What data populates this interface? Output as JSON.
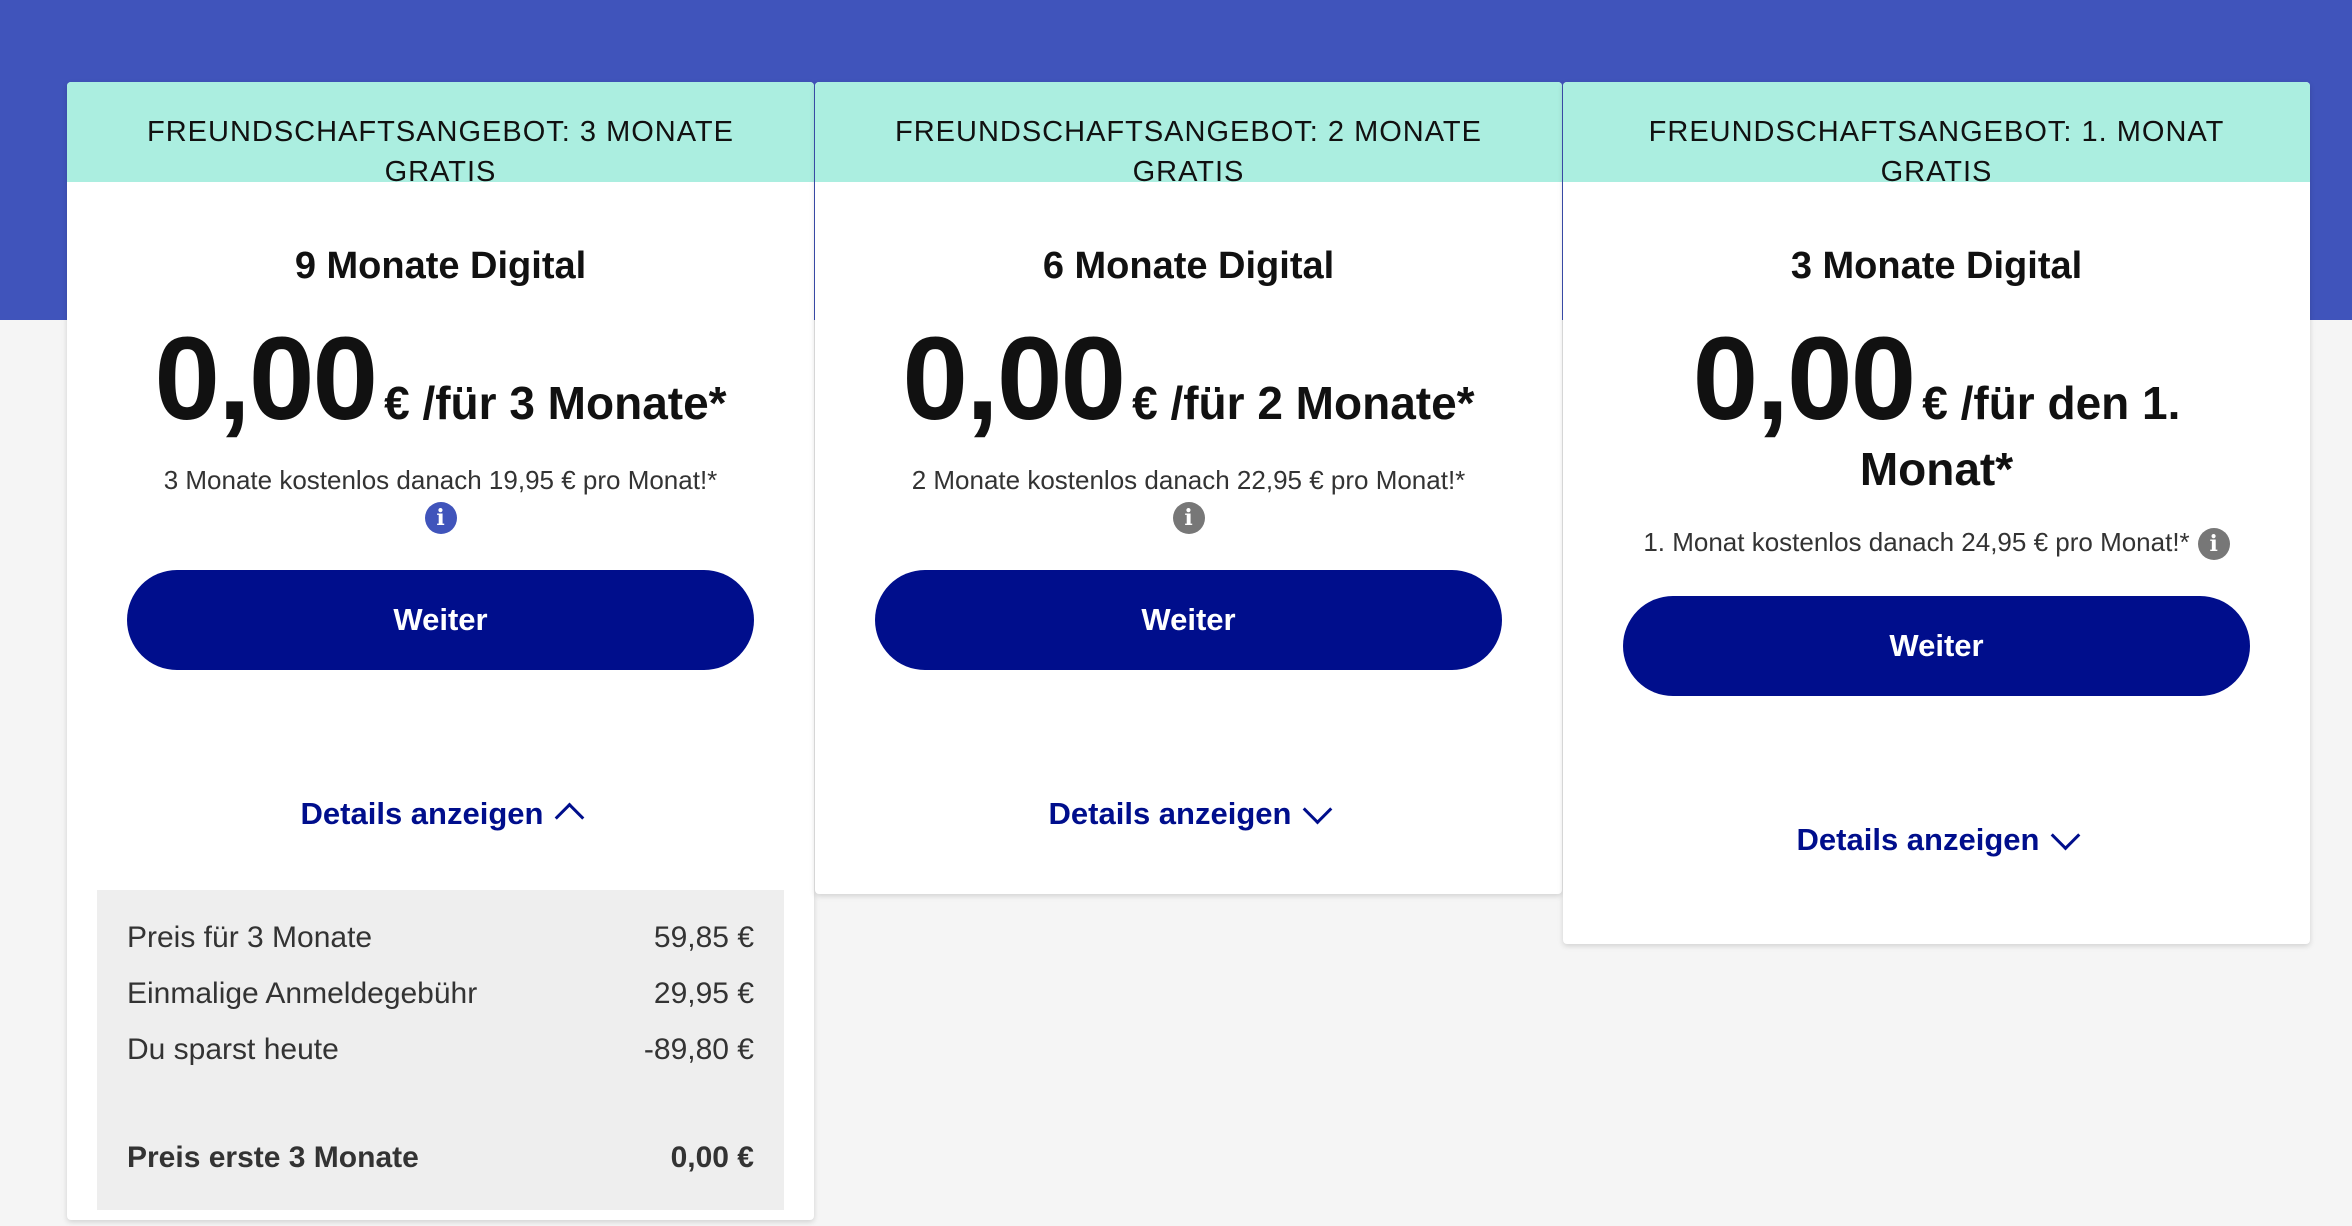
{
  "colors": {
    "top_band": "#4054bb",
    "offer_banner": "#abeee0",
    "button": "#000e8c",
    "link": "#000e8c",
    "info_icon_active": "#4054bb",
    "info_icon_muted": "#777777"
  },
  "plans": [
    {
      "offer_banner": "FREUNDSCHAFTSANGEBOT: 3 MONATE GRATIS",
      "title": "9 Monate Digital",
      "price": "0,00",
      "price_suffix": "€ /für 3 Monate*",
      "note": "3 Monate kostenlos danach 19,95 € pro Monat!*",
      "info_icon": "info-icon",
      "info_glyph": "i",
      "button_label": "Weiter",
      "details_label": "Details anzeigen",
      "details_expanded": true,
      "details": {
        "rows": [
          {
            "label": "Preis für 3 Monate",
            "value": "59,85 €"
          },
          {
            "label": "Einmalige Anmeldegebühr",
            "value": "29,95 €"
          },
          {
            "label": "Du sparst heute",
            "value": "-89,80 €"
          }
        ],
        "total": {
          "label": "Preis erste 3 Monate",
          "value": "0,00 €"
        }
      }
    },
    {
      "offer_banner": "FREUNDSCHAFTSANGEBOT: 2 MONATE GRATIS",
      "title": "6 Monate Digital",
      "price": "0,00",
      "price_suffix": "€ /für 2 Monate*",
      "note": "2 Monate kostenlos danach 22,95 € pro Monat!*",
      "info_icon": "info-icon",
      "info_glyph": "i",
      "button_label": "Weiter",
      "details_label": "Details anzeigen",
      "details_expanded": false
    },
    {
      "offer_banner": "FREUNDSCHAFTSANGEBOT: 1. MONAT GRATIS",
      "title": "3 Monate Digital",
      "price": "0,00",
      "price_suffix": "€ /für den 1. Monat*",
      "note": "1. Monat kostenlos danach 24,95 € pro Monat!*",
      "info_icon": "info-icon",
      "info_glyph": "i",
      "button_label": "Weiter",
      "details_label": "Details anzeigen",
      "details_expanded": false
    }
  ]
}
